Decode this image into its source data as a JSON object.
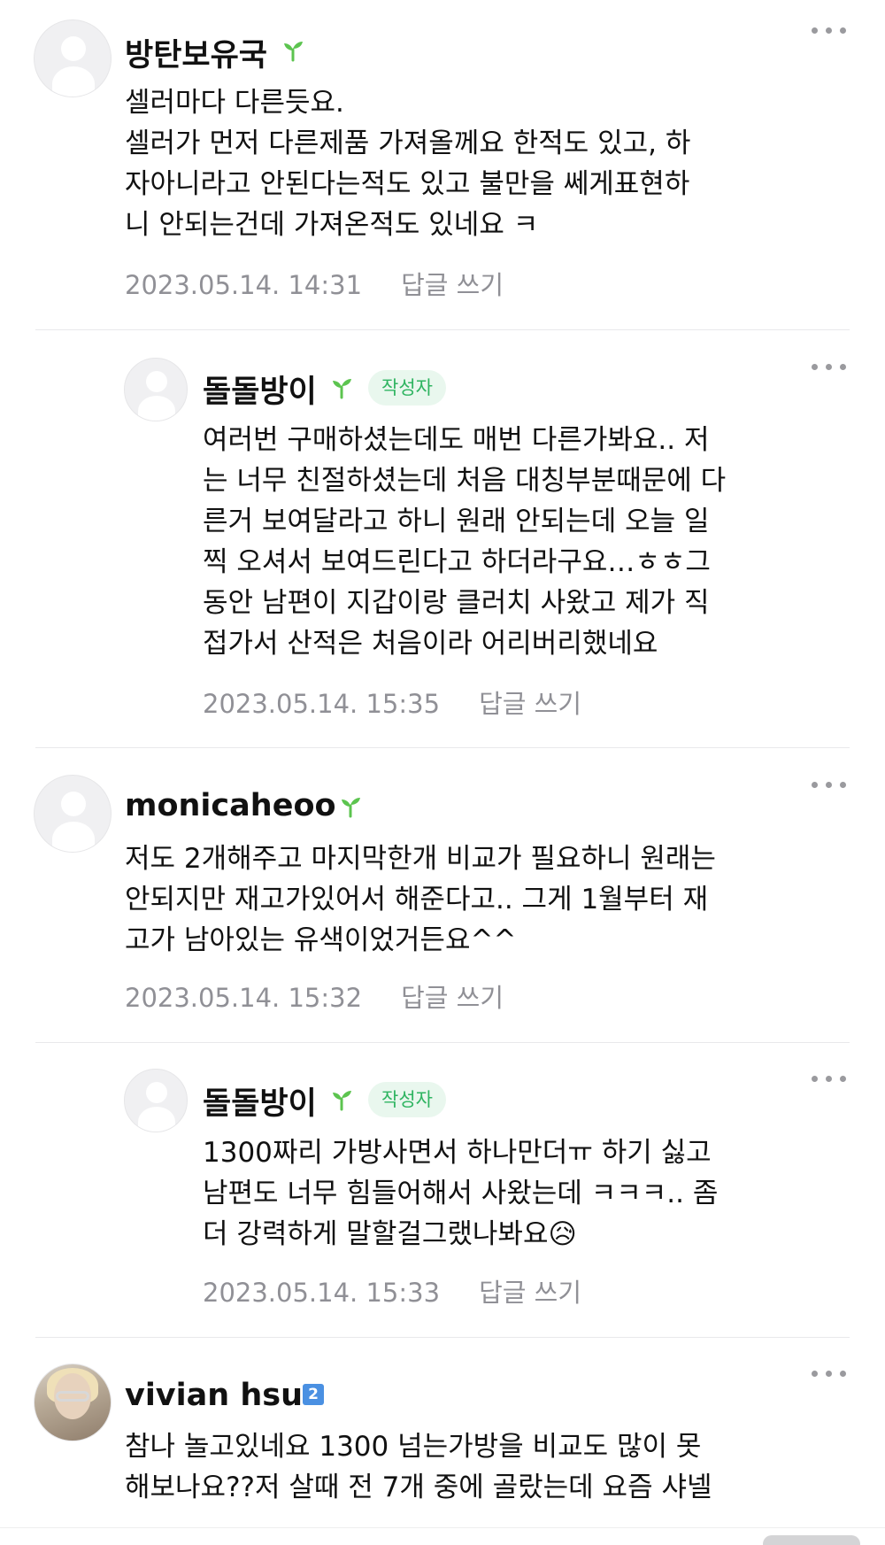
{
  "comments": [
    {
      "nickname": "방탄보유국",
      "author_badge": "",
      "lines": [
        "셀러마다 다른듯요.",
        "셀러가 먼저 다른제품 가져올께요  한적도 있고, 하",
        "자아니라고 안된다는적도 있고  불만을 쎄게표현하",
        "니 안되는건데 가져온적도 있네요 ㅋ"
      ],
      "date": "2023.05.14. 14:31",
      "reply_label": "답글 쓰기"
    },
    {
      "nickname": "돌돌방이",
      "author_badge": "작성자",
      "lines": [
        "여러번 구매하셨는데도 매번 다른가봐요.. 저",
        "는 너무 친절하셨는데 처음 대칭부분때문에 다",
        "른거 보여달라고 하니 원래 안되는데 오늘 일",
        "찍 오셔서 보여드린다고 하더라구요…ㅎㅎ그",
        "동안 남편이 지갑이랑 클러치 사왔고 제가 직",
        "접가서 산적은 처음이라 어리버리했네요"
      ],
      "date": "2023.05.14. 15:35",
      "reply_label": "답글 쓰기"
    },
    {
      "nickname": "monicaheoo",
      "author_badge": "",
      "lines": [
        "저도 2개해주고 마지막한개 비교가 필요하니 원래는",
        "안되지만 재고가있어서 해준다고.. 그게 1월부터 재",
        "고가 남아있는 유색이었거든요^^"
      ],
      "date": "2023.05.14. 15:32",
      "reply_label": "답글 쓰기"
    },
    {
      "nickname": "돌돌방이",
      "author_badge": "작성자",
      "lines": [
        "1300짜리 가방사면서 하나만더ㅠ 하기 싫고",
        "남편도 너무 힘들어해서 사왔는데 ㅋㅋㅋ.. 좀",
        "더 강력하게 말할걸그랬나봐요😥"
      ],
      "date": "2023.05.14. 15:33",
      "reply_label": "답글 쓰기"
    },
    {
      "nickname": "vivian hsu",
      "level_badge": "2",
      "lines": [
        "참나 놀고있네요 1300 넘는가방을 비교도 많이 못",
        "해보나요??저 살때 전 7개 중에 골랐는데 요즘 샤넬"
      ]
    }
  ],
  "colors": {
    "sprout": "#5cc44f",
    "author_badge_bg": "#e9f7ee",
    "author_badge_text": "#2fb461",
    "meta_text": "#909096",
    "divider": "#e9e9eb"
  },
  "icons": {
    "sprout": "sprout-icon",
    "more": "more-dots-icon",
    "level": "level-badge-icon"
  }
}
